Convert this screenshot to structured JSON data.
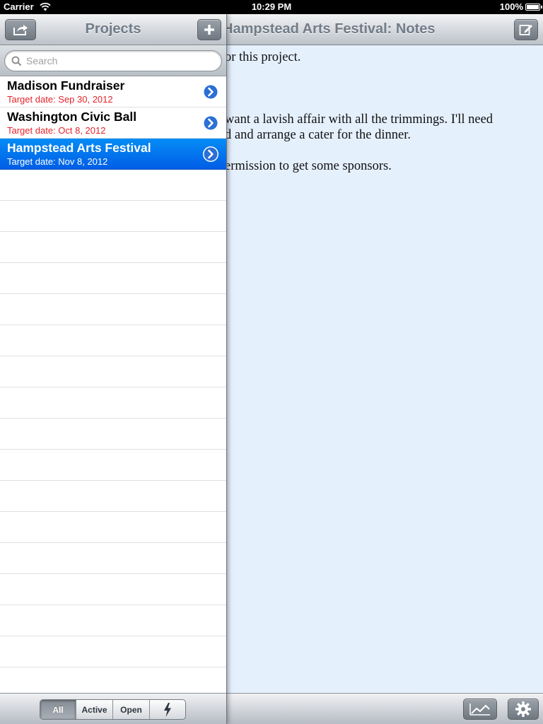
{
  "status_bar": {
    "carrier": "Carrier",
    "time": "10:29 PM",
    "battery": "100%"
  },
  "detail": {
    "title": "Hampstead Arts Festival: Notes",
    "notes_lines": [
      "or this project.",
      "want a lavish affair with all the trimmings. I'll need",
      "d and arrange a cater for the dinner.",
      "ermission to get some sponsors."
    ],
    "background_color": "#e5f0fd"
  },
  "popover": {
    "title": "Projects",
    "search": {
      "placeholder": "Search",
      "value": ""
    },
    "projects": [
      {
        "name": "Madison Fundraiser",
        "target": "Target date: Sep 30, 2012",
        "selected": false
      },
      {
        "name": "Washington Civic Ball",
        "target": "Target date: Oct 8, 2012",
        "selected": false
      },
      {
        "name": "Hampstead Arts Festival",
        "target": "Target date: Nov 8, 2012",
        "selected": true
      }
    ],
    "filter": {
      "segments": [
        "All",
        "Active",
        "Open"
      ],
      "selected": "All",
      "extra_icon": "lightning-icon"
    }
  },
  "colors": {
    "selection": "#0a72f0",
    "date_text": "#e3242b",
    "nav_title": "#717c88"
  }
}
